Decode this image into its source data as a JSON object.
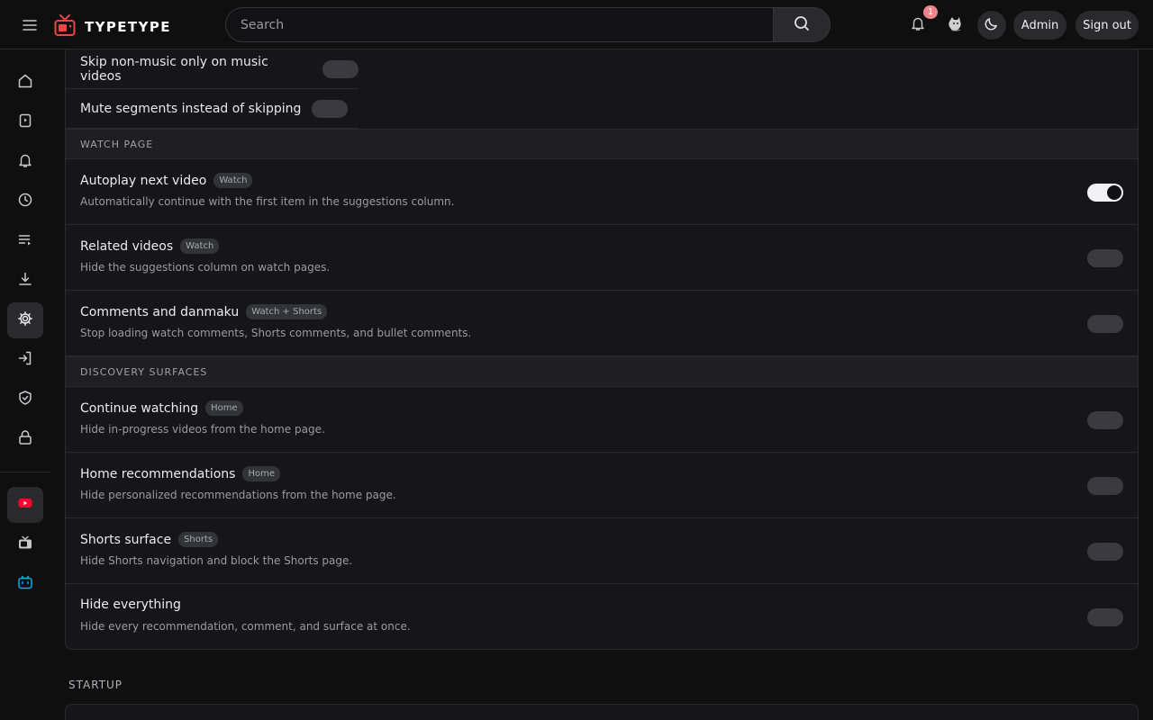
{
  "header": {
    "logo_text": "TYPETYPE",
    "search_placeholder": "Search",
    "notification_count": "1",
    "admin_label": "Admin",
    "signout_label": "Sign out"
  },
  "sidebar": {
    "items": [
      {
        "name": "home-icon"
      },
      {
        "name": "subscriptions-icon"
      },
      {
        "name": "bell-icon"
      },
      {
        "name": "history-icon"
      },
      {
        "name": "playlist-icon"
      },
      {
        "name": "download-icon"
      },
      {
        "name": "gear-icon",
        "active": true
      },
      {
        "name": "login-icon"
      },
      {
        "name": "shield-check-icon"
      },
      {
        "name": "lock-icon"
      }
    ],
    "sources": [
      {
        "name": "youtube-icon",
        "active": true,
        "color": "#ff0033"
      },
      {
        "name": "tv-icon"
      },
      {
        "name": "bilibili-icon",
        "color": "#00aeec"
      }
    ]
  },
  "settings": {
    "top_rows": [
      {
        "label": "Skip non-music only on music videos",
        "on": false
      },
      {
        "label": "Mute segments instead of skipping",
        "on": false
      }
    ],
    "sections": [
      {
        "title": "WATCH PAGE",
        "rows": [
          {
            "title": "Autoplay next video",
            "tag": "Watch",
            "desc": "Automatically continue with the first item in the suggestions column.",
            "on": true
          },
          {
            "title": "Related videos",
            "tag": "Watch",
            "desc": "Hide the suggestions column on watch pages.",
            "on": false
          },
          {
            "title": "Comments and danmaku",
            "tag": "Watch + Shorts",
            "desc": "Stop loading watch comments, Shorts comments, and bullet comments.",
            "on": false
          }
        ]
      },
      {
        "title": "DISCOVERY SURFACES",
        "rows": [
          {
            "title": "Continue watching",
            "tag": "Home",
            "desc": "Hide in-progress videos from the home page.",
            "on": false
          },
          {
            "title": "Home recommendations",
            "tag": "Home",
            "desc": "Hide personalized recommendations from the home page.",
            "on": false
          },
          {
            "title": "Shorts surface",
            "tag": "Shorts",
            "desc": "Hide Shorts navigation and block the Shorts page.",
            "on": false
          },
          {
            "title": "Hide everything",
            "tag": "",
            "desc": "Hide every recommendation, comment, and surface at once.",
            "on": false
          }
        ]
      }
    ]
  },
  "startup": {
    "title": "STARTUP"
  },
  "colors": {
    "accent_logo": "#ef4444",
    "background": "#0f0f10",
    "panel": "#161618"
  }
}
